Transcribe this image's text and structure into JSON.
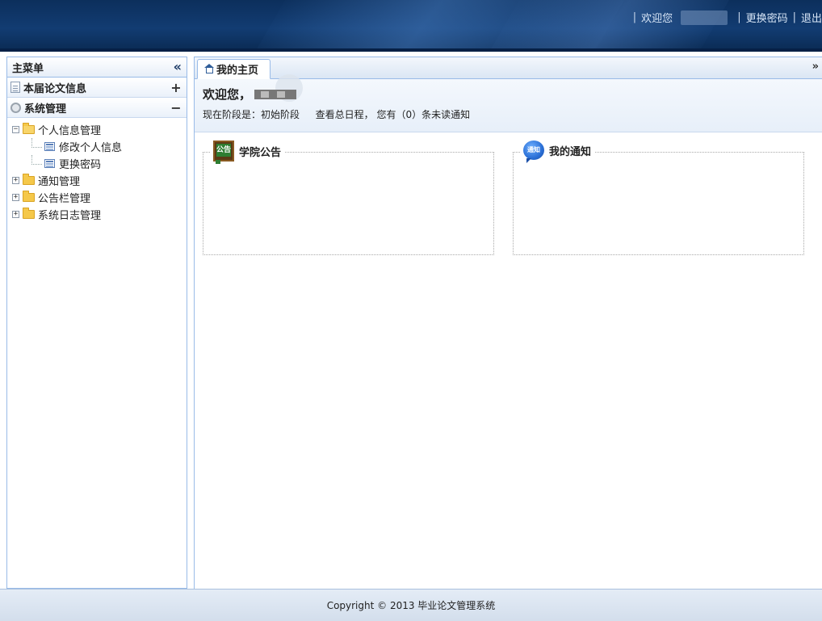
{
  "header": {
    "nav": {
      "welcome": "欢迎您",
      "change_password": "更换密码",
      "logout": "退出",
      "separator": "|"
    }
  },
  "sidebar": {
    "title": "主菜单",
    "collapse_symbol": "«",
    "sections": [
      {
        "label": "本届论文信息",
        "toggle": "+",
        "icon": "document-icon"
      },
      {
        "label": "系统管理",
        "toggle": "−",
        "icon": "gear-icon"
      }
    ],
    "tree": {
      "personal": {
        "label": "个人信息管理",
        "expander": "−"
      },
      "personal_children": [
        {
          "label": "修改个人信息"
        },
        {
          "label": "更换密码"
        }
      ],
      "notice_mgmt": {
        "label": "通知管理",
        "expander": "+"
      },
      "bulletin_mgmt": {
        "label": "公告栏管理",
        "expander": "+"
      },
      "log_mgmt": {
        "label": "系统日志管理",
        "expander": "+"
      }
    }
  },
  "tabs": {
    "active": {
      "label": "我的主页"
    },
    "more_symbol": "»"
  },
  "welcome": {
    "greeting": "欢迎您，",
    "stage_text": "现在阶段是：初始阶段",
    "schedule_link": "查看总日程，",
    "unread_text": "您有（0）条未读通知"
  },
  "panels": {
    "announcements": {
      "title": "学院公告",
      "icon_text": "公告"
    },
    "notifications": {
      "title": "我的通知",
      "icon_text": "通知"
    }
  },
  "footer": {
    "copyright": "Copyright © 2013 毕业论文管理系统"
  },
  "colors": {
    "header_bg": "#123c72",
    "panel_border": "#99bbe8",
    "footer_bg": "#d3deec"
  }
}
